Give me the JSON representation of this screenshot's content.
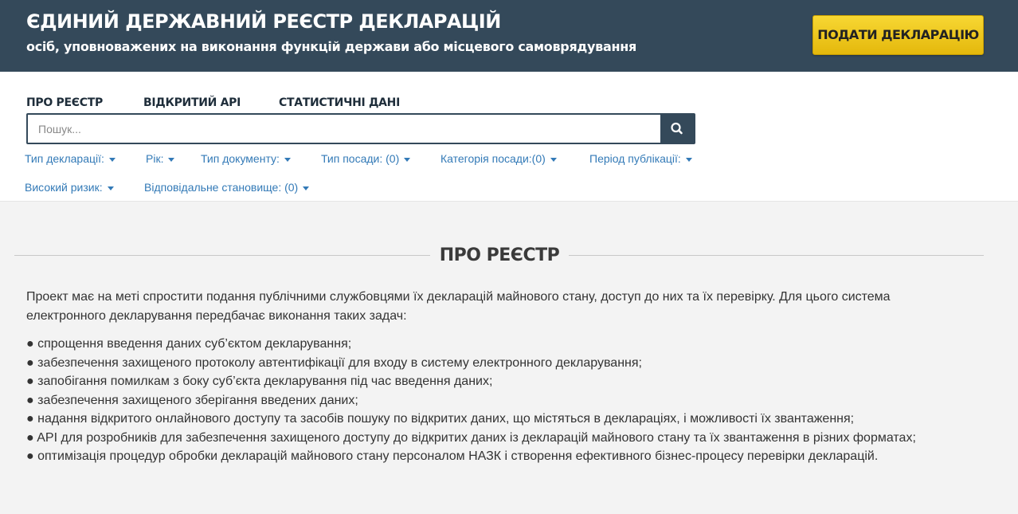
{
  "header": {
    "title": "ЄДИНИЙ ДЕРЖАВНИЙ РЕЄСТР ДЕКЛАРАЦІЙ",
    "subtitle": "осіб, уповноважених на виконання функцій держави або місцевого самоврядування",
    "submit_label": "ПОДАТИ ДЕКЛАРАЦІЮ"
  },
  "nav": {
    "links": [
      "ПРО РЕЄСТР",
      "ВІДКРИТИЙ API",
      "СТАТИСТИЧНІ ДАНІ"
    ]
  },
  "search": {
    "placeholder": "Пошук...",
    "value": "",
    "icon": "search-icon"
  },
  "filters": {
    "row1": [
      "Тип декларації:",
      "Рік:",
      "Тип документу:",
      "Тип посади: (0)",
      "Категорія посади:(0)",
      "Період публікації:"
    ],
    "row2": [
      "Високий ризик:",
      "Відповідальне становище: (0)"
    ]
  },
  "section": {
    "title": "ПРО РЕЄСТР",
    "intro": "Проект має на меті спростити подання публічними службовцями їх декларацій майнового стану, доступ до них та їх перевірку. Для цього система електронного декларування передбачає виконання таких задач:",
    "items": [
      "● спрощення введення даних суб’єктом декларування;",
      "● забезпечення захищеного протоколу автентифікації для входу в систему електронного декларування;",
      "● запобігання помилкам з боку суб’єкта декларування під час введення даних;",
      "● забезпечення захищеного зберігання введених даних;",
      "● надання відкритого онлайнового доступу та засобів пошуку по відкритих даних, що містяться в деклараціях, і можливості їх звантаження;",
      "● API для розробників для забезпечення захищеного доступу до відкритих даних із декларацій майнового стану та їх звантаження в різних форматах;",
      "● оптимізація процедур обробки декларацій майнового стану персоналом НАЗК і створення ефективного бізнес-процесу перевірки декларацій."
    ]
  },
  "colors": {
    "header_bg": "#34495a",
    "accent_yellow": "#f4cd22",
    "link_blue": "#337ab7"
  }
}
